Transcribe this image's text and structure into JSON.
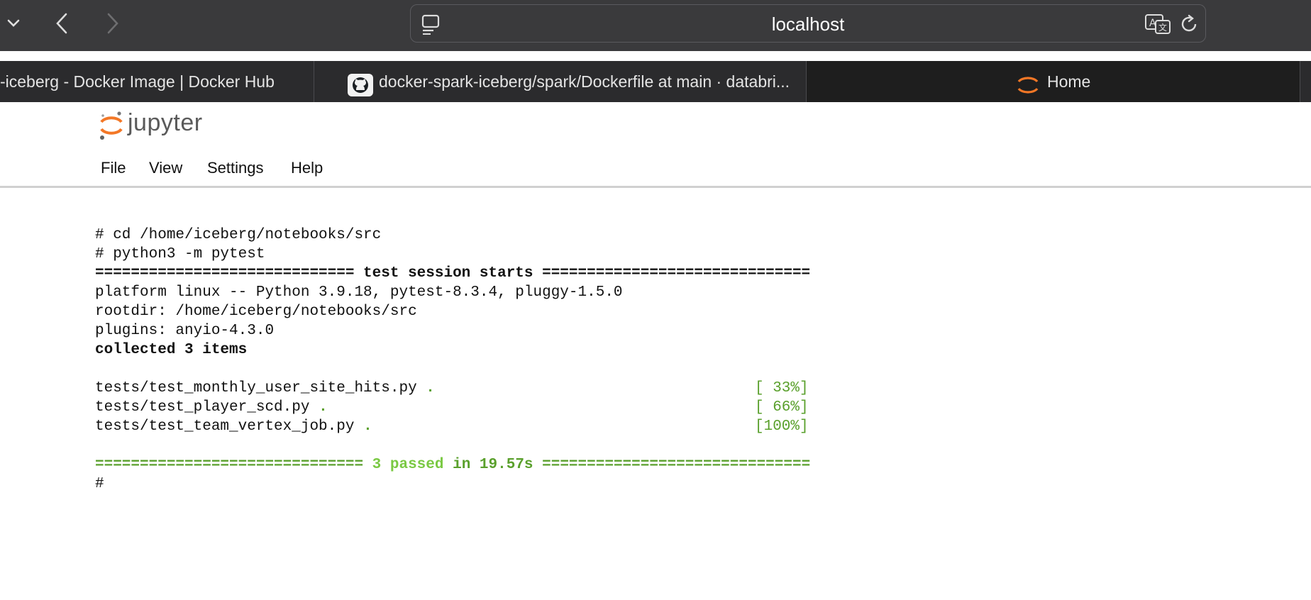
{
  "browser": {
    "url": "localhost",
    "tabs": [
      {
        "title": "-iceberg - Docker Image | Docker Hub",
        "favicon": "docker-icon",
        "active": false
      },
      {
        "title": "docker-spark-iceberg/spark/Dockerfile at main · databri...",
        "favicon": "github-icon",
        "active": false
      },
      {
        "title": "Home",
        "favicon": "jupyter-icon",
        "active": true
      }
    ]
  },
  "jupyter": {
    "logo_text": "jupyter",
    "menu": [
      "File",
      "View",
      "Settings",
      "Help"
    ]
  },
  "terminal": {
    "cmd1": "# cd /home/iceberg/notebooks/src",
    "cmd2": "# python3 -m pytest",
    "session_header": "============================= test session starts ==============================",
    "platform": "platform linux -- Python 3.9.18, pytest-8.3.4, pluggy-1.5.0",
    "rootdir": "rootdir: /home/iceberg/notebooks/src",
    "plugins": "plugins: anyio-4.3.0",
    "collected": "collected 3 items",
    "tests": [
      {
        "file": "tests/test_monthly_user_site_hits.py",
        "dot": ".",
        "progress": "[ 33%]"
      },
      {
        "file": "tests/test_player_scd.py",
        "dot": ".",
        "progress": "[ 66%]"
      },
      {
        "file": "tests/test_team_vertex_job.py",
        "dot": ".",
        "progress": "[100%]"
      }
    ],
    "summary_left": "============================== ",
    "summary_passed": "3 passed",
    "summary_in": " in 19.57s ",
    "summary_right": "==============================",
    "prompt": "#"
  }
}
